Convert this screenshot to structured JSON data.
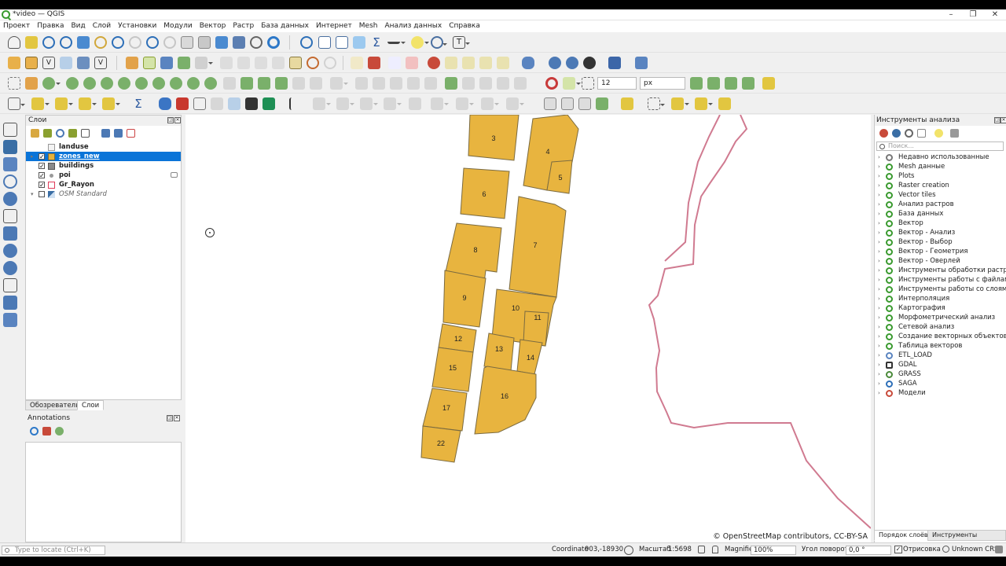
{
  "window": {
    "title": "*video — QGIS",
    "minimize": "–",
    "restore": "❐",
    "close": "✕"
  },
  "menu": [
    "Проект",
    "Правка",
    "Вид",
    "Слой",
    "Установки",
    "Модули",
    "Вектор",
    "Растр",
    "База данных",
    "Интернет",
    "Mesh",
    "Анализ данных",
    "Справка"
  ],
  "snapping": {
    "tolerance": "12",
    "units": "px"
  },
  "layers_panel": {
    "title": "Слои",
    "layers": [
      {
        "name": "landuse",
        "checked": false,
        "selected": false,
        "italic": false,
        "color": "#f3f3f3"
      },
      {
        "name": "zones_new",
        "checked": true,
        "selected": true,
        "italic": false,
        "color": "#e5b13b"
      },
      {
        "name": "buildings",
        "checked": true,
        "selected": false,
        "italic": false,
        "color": "#8a8a8a"
      },
      {
        "name": "poi",
        "checked": true,
        "selected": false,
        "italic": false,
        "color": "#9a9a9a"
      },
      {
        "name": "Gr_Rayon",
        "checked": true,
        "selected": false,
        "italic": false,
        "color": "#e03c5a"
      },
      {
        "name": "OSM Standard",
        "checked": false,
        "selected": false,
        "italic": true,
        "color": "#3a6ea5"
      }
    ],
    "tabs": [
      "Обозреватель",
      "Слои"
    ],
    "active_tab": "Слои"
  },
  "annotations_panel": {
    "title": "Annotations"
  },
  "map": {
    "zone_fill": "#e8b43f",
    "zone_stroke": "#7a6a40",
    "boundary_color": "#d07a90",
    "zones": [
      {
        "label": "3"
      },
      {
        "label": "4"
      },
      {
        "label": "5"
      },
      {
        "label": "6"
      },
      {
        "label": "7"
      },
      {
        "label": "8"
      },
      {
        "label": "9"
      },
      {
        "label": "10"
      },
      {
        "label": "11"
      },
      {
        "label": "12"
      },
      {
        "label": "13"
      },
      {
        "label": "14"
      },
      {
        "label": "15"
      },
      {
        "label": "16"
      },
      {
        "label": "17"
      },
      {
        "label": "22"
      }
    ],
    "attribution": "© OpenStreetMap contributors, CC-BY-SA"
  },
  "processing": {
    "title": "Инструменты анализа",
    "search_placeholder": "Поиск...",
    "items": [
      "Недавно использованные",
      "Mesh данные",
      "Plots",
      "Raster creation",
      "Vector tiles",
      "Анализ растров",
      "База данных",
      "Вектор",
      "Вектор - Анализ",
      "Вектор - Выбор",
      "Вектор - Геометрия",
      "Вектор - Оверлей",
      "Инструменты обработки растра",
      "Инструменты работы с файлами",
      "Инструменты работы со слоями",
      "Интерполяция",
      "Картография",
      "Морфометрический анализ",
      "Сетевой анализ",
      "Создание векторных объектов",
      "Таблица векторов",
      "ETL_LOAD",
      "GDAL",
      "GRASS",
      "SAGA",
      "Модели"
    ],
    "tabs": [
      "Порядок слоёв",
      "Инструменты анализа"
    ]
  },
  "status": {
    "locate_placeholder": "Type to locate (Ctrl+K)",
    "coordinate_label": "Coordinate",
    "coordinate_value": "903,-18930",
    "scale_label": "Масштаб",
    "scale_value": "1:5698",
    "magnifier_label": "Magnifier",
    "magnifier_value": "100%",
    "rotation_label": "Угол поворота",
    "rotation_value": "0,0 °",
    "render_label": "Отрисовка",
    "render_checked": true,
    "crs": "Unknown CRS"
  }
}
